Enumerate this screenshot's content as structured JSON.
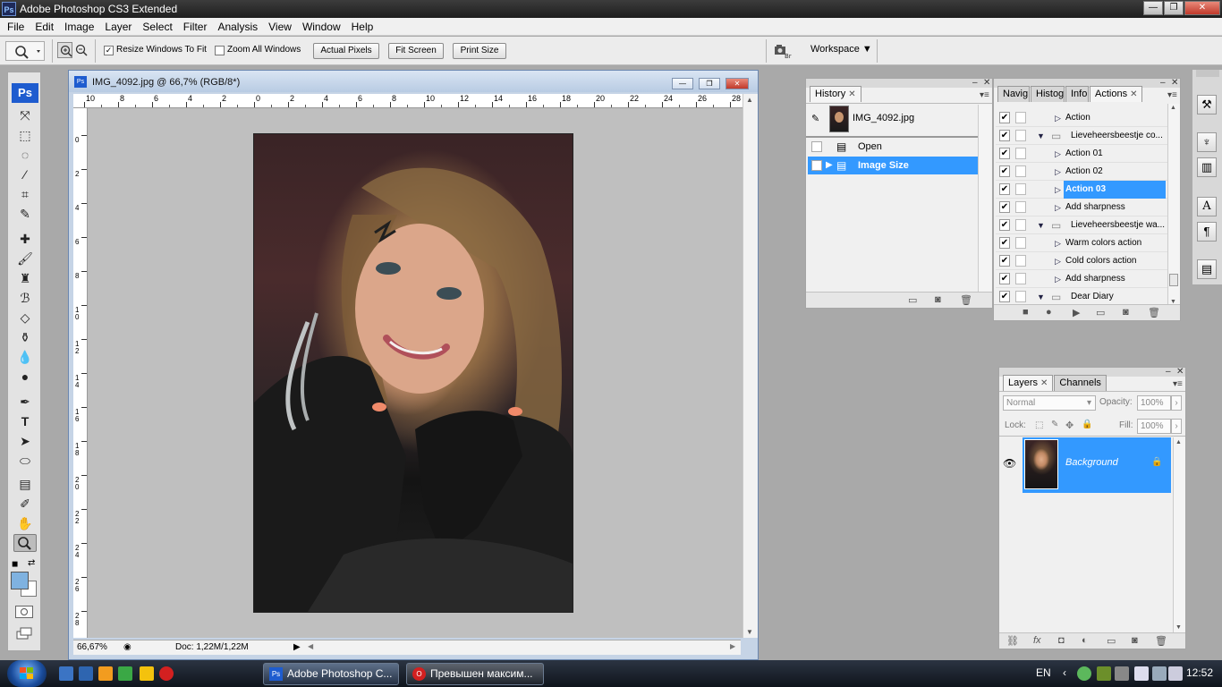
{
  "app": {
    "title": "Adobe Photoshop CS3 Extended",
    "logo": "Ps"
  },
  "window_controls": {
    "minimize": "—",
    "restore": "❐",
    "close": "✕"
  },
  "menu": [
    "File",
    "Edit",
    "Image",
    "Layer",
    "Select",
    "Filter",
    "Analysis",
    "View",
    "Window",
    "Help"
  ],
  "options_bar": {
    "resize_windows_label": "Resize Windows To Fit",
    "resize_windows_checked": "✓",
    "zoom_all_label": "Zoom All Windows",
    "actual_pixels": "Actual Pixels",
    "fit_screen": "Fit Screen",
    "print_size": "Print Size",
    "workspace": "Workspace ▼"
  },
  "toolbox": {
    "logo": "Ps",
    "tools": [
      "move-tool-icon",
      "marquee-tool-icon",
      "lasso-tool-icon",
      "magic-wand-icon",
      "crop-tool-icon",
      "slice-tool-icon",
      "healing-brush-icon",
      "brush-tool-icon",
      "clone-stamp-icon",
      "history-brush-icon",
      "eraser-tool-icon",
      "paint-bucket-icon",
      "blur-tool-icon",
      "dodge-tool-icon",
      "pen-tool-icon",
      "type-tool-icon",
      "path-selection-icon",
      "shape-tool-icon",
      "notes-tool-icon",
      "eyedropper-icon",
      "hand-tool-icon",
      "zoom-tool-icon"
    ],
    "foreground_color": "#7fb2e0",
    "background_color": "#ffffff"
  },
  "document": {
    "title": "IMG_4092.jpg @ 66,7% (RGB/8*)",
    "icon": "Ps",
    "zoom": "66,67%",
    "doc_info": "Doc: 1,22M/1,22M",
    "ruler_h": [
      "10",
      "8",
      "6",
      "4",
      "2",
      "0",
      "2",
      "4",
      "6",
      "8",
      "10",
      "12",
      "14",
      "16",
      "18",
      "20",
      "22",
      "24",
      "26",
      "28"
    ],
    "ruler_v": [
      "0",
      "2",
      "4",
      "6",
      "8",
      "1\n0",
      "1\n2",
      "1\n4",
      "1\n6",
      "1\n8",
      "2\n0",
      "2\n2",
      "2\n4",
      "2\n6",
      "2\n8"
    ]
  },
  "history_panel": {
    "tab": "History",
    "snapshot": "IMG_4092.jpg",
    "states": [
      {
        "label": "Open",
        "selected": false
      },
      {
        "label": "Image Size",
        "selected": true
      }
    ]
  },
  "actions_panel": {
    "tabs": [
      "Navig",
      "Histog",
      "Info",
      "Actions"
    ],
    "active_tab": "Actions",
    "rows": [
      {
        "label": "Action",
        "kind": "action",
        "selected": false
      },
      {
        "label": "Lieveheersbeestje co...",
        "kind": "set",
        "selected": false
      },
      {
        "label": "Action 01",
        "kind": "action",
        "selected": false
      },
      {
        "label": "Action 02",
        "kind": "action",
        "selected": false
      },
      {
        "label": "Action 03",
        "kind": "action",
        "selected": true
      },
      {
        "label": "Add sharpness",
        "kind": "action",
        "selected": false
      },
      {
        "label": "Lieveheersbeestje wa...",
        "kind": "set",
        "selected": false
      },
      {
        "label": "Warm colors action",
        "kind": "action",
        "selected": false
      },
      {
        "label": "Cold colors action",
        "kind": "action",
        "selected": false
      },
      {
        "label": "Add sharpness",
        "kind": "action",
        "selected": false
      },
      {
        "label": "Dear Diary",
        "kind": "set",
        "selected": false
      }
    ],
    "check": "✔"
  },
  "layers_panel": {
    "tabs": [
      "Layers",
      "Channels"
    ],
    "blend_mode": "Normal",
    "opacity_label": "Opacity:",
    "opacity_value": "100%",
    "lock_label": "Lock:",
    "fill_label": "Fill:",
    "fill_value": "100%",
    "layer_name": "Background"
  },
  "taskbar": {
    "tasks": [
      {
        "label": "Adobe Photoshop C...",
        "active": true,
        "icon": "Ps"
      },
      {
        "label": "Превышен максим...",
        "active": false,
        "icon": "O"
      }
    ],
    "language": "EN",
    "clock": "12:52"
  }
}
